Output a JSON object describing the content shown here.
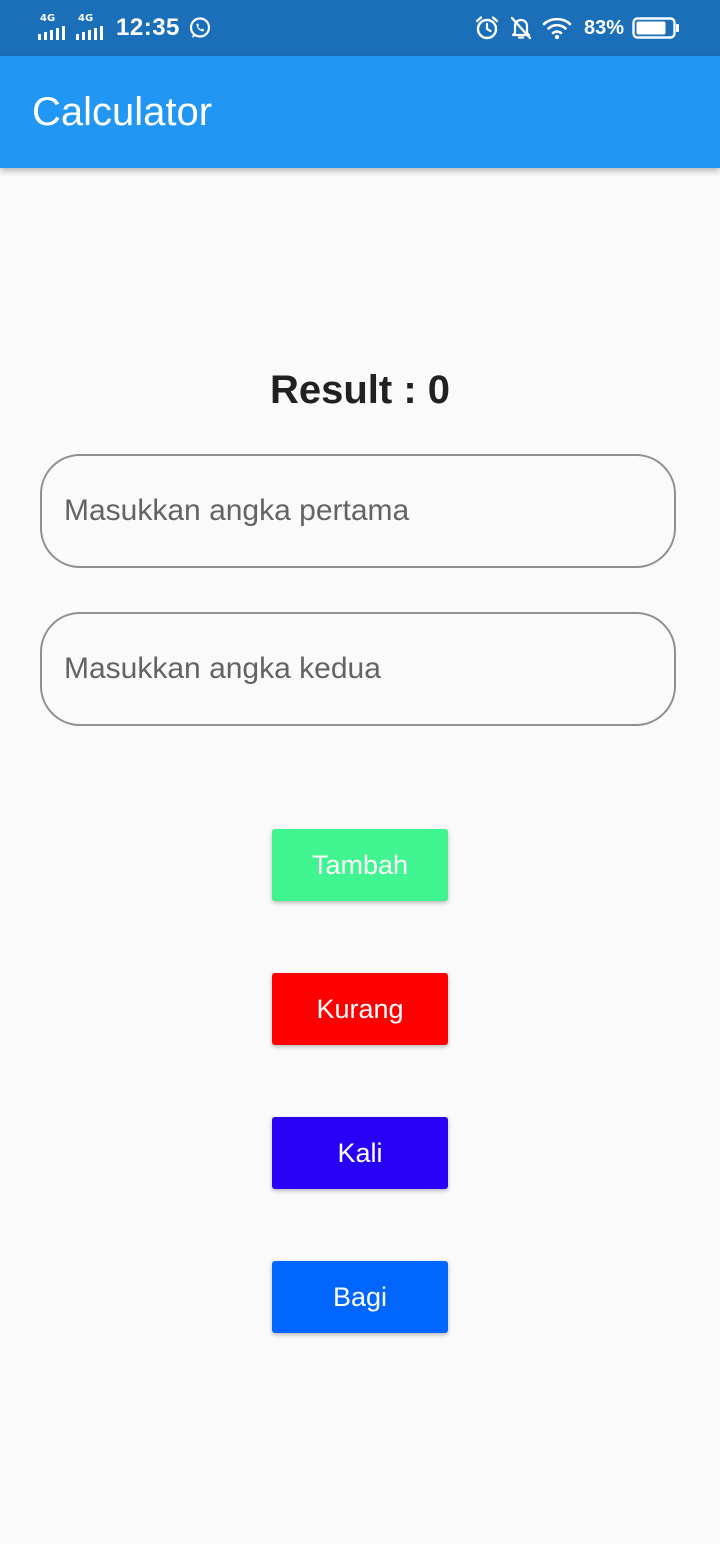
{
  "status_bar": {
    "network_1": "4G",
    "network_2": "4G",
    "time": "12:35",
    "battery_percent": "83%",
    "battery_level": 0.83,
    "icons": [
      "signal-icon",
      "whatsapp-icon",
      "alarm-icon",
      "notifications-off-icon",
      "wifi-icon",
      "battery-icon"
    ]
  },
  "app_bar": {
    "title": "Calculator",
    "color": "#2196f3"
  },
  "main": {
    "result_text": "Result : 0",
    "first_input": {
      "value": "",
      "placeholder": "Masukkan angka pertama"
    },
    "second_input": {
      "value": "",
      "placeholder": "Masukkan angka kedua"
    },
    "buttons": [
      {
        "label": "Tambah",
        "color": "#40f58f"
      },
      {
        "label": "Kurang",
        "color": "#ff0000"
      },
      {
        "label": "Kali",
        "color": "#2700f5"
      },
      {
        "label": "Bagi",
        "color": "#0066ff"
      }
    ]
  }
}
